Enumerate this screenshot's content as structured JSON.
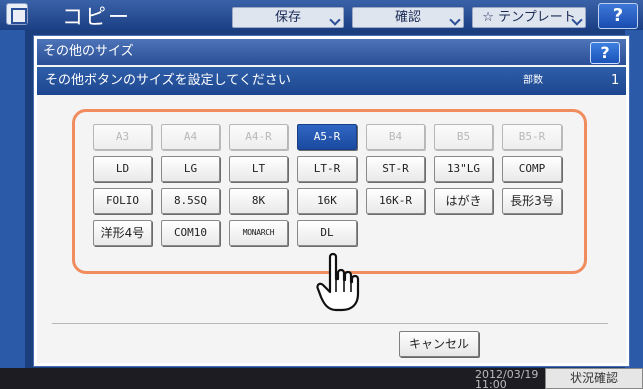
{
  "background": {
    "title": "コピー",
    "tabs": [
      {
        "label": "保存"
      },
      {
        "label": "確認"
      },
      {
        "label": "☆ テンプレート"
      }
    ],
    "help_label": "?",
    "clock": "2012/03/19\n11:00",
    "status_button": "状況確認"
  },
  "dialog": {
    "title": "その他のサイズ",
    "help_label": "?",
    "instruction": "その他ボタンのサイズを設定してください",
    "copies_label": "部数",
    "copies_value": "1",
    "sizes": [
      {
        "label": "A3",
        "state": "disabled"
      },
      {
        "label": "A4",
        "state": "disabled"
      },
      {
        "label": "A4-R",
        "state": "disabled"
      },
      {
        "label": "A5-R",
        "state": "selected"
      },
      {
        "label": "B4",
        "state": "disabled"
      },
      {
        "label": "B5",
        "state": "disabled"
      },
      {
        "label": "B5-R",
        "state": "disabled"
      },
      {
        "label": "LD",
        "state": "normal"
      },
      {
        "label": "LG",
        "state": "normal"
      },
      {
        "label": "LT",
        "state": "normal"
      },
      {
        "label": "LT-R",
        "state": "normal"
      },
      {
        "label": "ST-R",
        "state": "normal"
      },
      {
        "label": "13\"LG",
        "state": "normal"
      },
      {
        "label": "COMP",
        "state": "normal"
      },
      {
        "label": "FOLIO",
        "state": "normal"
      },
      {
        "label": "8.5SQ",
        "state": "normal"
      },
      {
        "label": "8K",
        "state": "normal"
      },
      {
        "label": "16K",
        "state": "normal"
      },
      {
        "label": "16K-R",
        "state": "normal"
      },
      {
        "label": "はがき",
        "state": "normal"
      },
      {
        "label": "長形3号",
        "state": "normal"
      },
      {
        "label": "洋形4号",
        "state": "normal"
      },
      {
        "label": "COM10",
        "state": "normal"
      },
      {
        "label": "MONARCH",
        "state": "normal"
      },
      {
        "label": "DL",
        "state": "normal"
      }
    ],
    "cancel_label": "キャンセル"
  },
  "colors": {
    "panel_border": "#f08c5e",
    "selected": "#1b4aa0",
    "title_bar": "#2a4f96"
  },
  "icons": [
    "app-icon",
    "hand-pointer-icon",
    "chevron-down-icon"
  ]
}
